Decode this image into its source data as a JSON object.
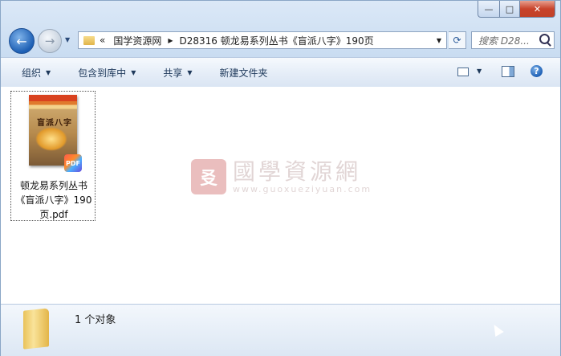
{
  "window": {
    "caption": {
      "minimize": "—",
      "maximize": "□",
      "close": "✕"
    }
  },
  "nav": {
    "back": "←",
    "forward": "→",
    "history_arrow": "▼",
    "breadcrumb": {
      "overflow": "«",
      "items": [
        "国学资源网",
        "D28316 顿龙易系列丛书《盲派八字》190页"
      ],
      "separator": "▶",
      "dropdown": "▼"
    },
    "refresh": "⟳",
    "search_placeholder": "搜索 D28..."
  },
  "toolbar": {
    "organize": "组织",
    "include_in_library": "包含到库中",
    "share": "共享",
    "new_folder": "新建文件夹",
    "dropdown": "▼",
    "help": "?"
  },
  "files": [
    {
      "name": "顿龙易系列丛书《盲派八字》190页.pdf",
      "thumb_title": "盲派八字",
      "badge": "PDF"
    }
  ],
  "watermark": {
    "cn": "國學資源網",
    "en": "www.guoxueziyuan.com",
    "seal": "㕛"
  },
  "status": {
    "count_text": "1 个对象"
  }
}
